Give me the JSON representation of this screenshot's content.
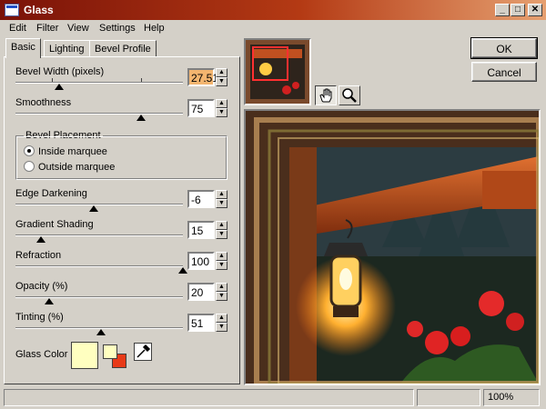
{
  "window": {
    "title": "Glass"
  },
  "titlebar_buttons": {
    "minimize": "_",
    "maximize": "□",
    "close": "✕"
  },
  "menu": [
    "Edit",
    "Filter",
    "View",
    "Settings",
    "Help"
  ],
  "tabs": [
    {
      "label": "Basic",
      "active": true
    },
    {
      "label": "Lighting",
      "active": false
    },
    {
      "label": "Bevel Profile",
      "active": false
    }
  ],
  "controls": {
    "bevel_width": {
      "label": "Bevel Width (pixels)",
      "value": "27.51",
      "fraction": 0.26
    },
    "smoothness": {
      "label": "Smoothness",
      "value": "75",
      "fraction": 0.75
    },
    "edge_darkening": {
      "label": "Edge Darkening",
      "value": "-6",
      "fraction": 0.47
    },
    "gradient_shading": {
      "label": "Gradient Shading",
      "value": "15",
      "fraction": 0.15
    },
    "refraction": {
      "label": "Refraction",
      "value": "100",
      "fraction": 1.0
    },
    "opacity": {
      "label": "Opacity (%)",
      "value": "20",
      "fraction": 0.2
    },
    "tinting": {
      "label": "Tinting (%)",
      "value": "51",
      "fraction": 0.51
    }
  },
  "bevel_placement": {
    "legend": "Bevel Placement",
    "options": [
      {
        "label": "Inside marquee",
        "selected": true
      },
      {
        "label": "Outside marquee",
        "selected": false
      }
    ]
  },
  "glass_color": {
    "label": "Glass Color",
    "color": "#ffffc0",
    "fg_color": "#ffffc0",
    "bg_color": "#e83a18"
  },
  "buttons": {
    "ok": "OK",
    "cancel": "Cancel"
  },
  "status": {
    "zoom": "100%"
  },
  "colors": {
    "title_start": "#7a1208",
    "title_end": "#e6a070",
    "highlight_value": "#f3b56f",
    "face": "#d4d0c8"
  },
  "icons": [
    "window-icon",
    "minimize-icon",
    "maximize-icon",
    "close-icon",
    "hand-pan-icon",
    "zoom-magnifier-icon",
    "eyedropper-icon"
  ]
}
